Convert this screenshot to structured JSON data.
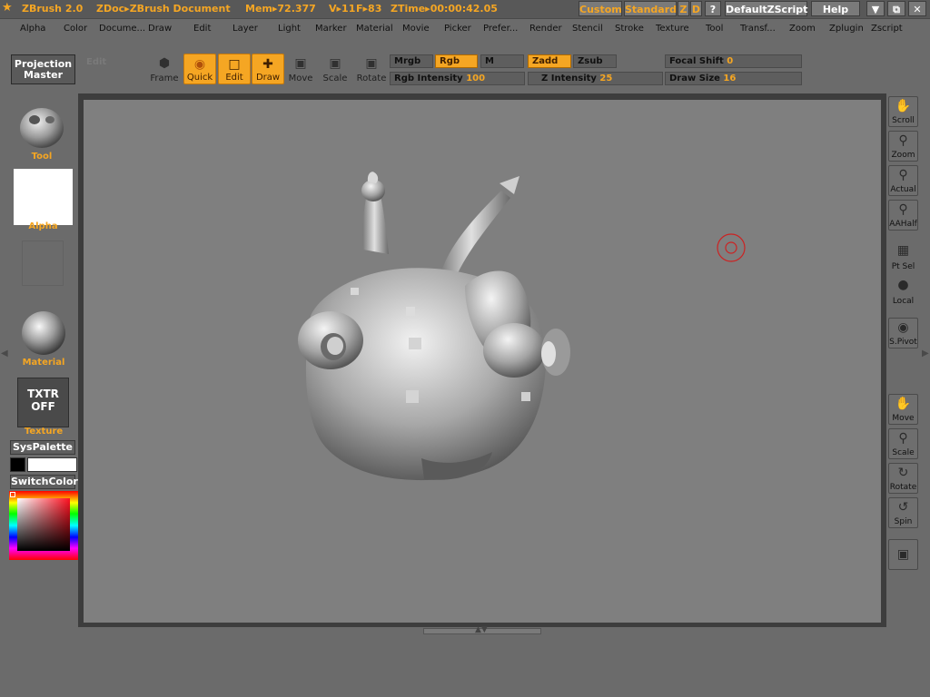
{
  "titlebar": {
    "app": "ZBrush 2.0",
    "doc": "ZDoc▸ZBrush Document",
    "mem": "Mem▸72.377",
    "verts": "V▸11",
    "faces": "F▸83",
    "ztime": "ZTime▸00:00:42.05",
    "custom": "Custom",
    "standard": "Standard",
    "z": "Z",
    "d": "D",
    "q": "?",
    "script": "DefaultZScript",
    "help": "Help"
  },
  "menu": [
    "Alpha",
    "Color",
    "Docume...",
    "Draw",
    "Edit",
    "Layer",
    "Light",
    "Marker",
    "Material",
    "Movie",
    "Picker",
    "Prefer...",
    "Render",
    "Stencil",
    "Stroke",
    "Texture",
    "Tool",
    "Transf...",
    "Zoom",
    "Zplugin",
    "Zscript"
  ],
  "toolbar": {
    "projection_master": "Projection Master",
    "edit_label": "Edit",
    "frame": "Frame",
    "quick": "Quick",
    "edit": "Edit",
    "draw": "Draw",
    "move": "Move",
    "scale": "Scale",
    "rotate": "Rotate",
    "mrgb": "Mrgb",
    "rgb": "Rgb",
    "m": "M",
    "zadd": "Zadd",
    "zsub": "Zsub",
    "rgb_intensity_label": "Rgb Intensity",
    "rgb_intensity_value": "100",
    "z_intensity_label": "Z Intensity",
    "z_intensity_value": "25",
    "focal_shift_label": "Focal Shift",
    "focal_shift_value": "0",
    "draw_size_label": "Draw Size",
    "draw_size_value": "16"
  },
  "left_panel": {
    "tool": "Tool",
    "alpha": "Alpha",
    "material": "Material",
    "texture_button": "TXTR OFF",
    "texture": "Texture",
    "syspalette": "SysPalette",
    "switchcolor": "SwitchColor"
  },
  "right_shelf": [
    "Scroll",
    "Zoom",
    "Actual",
    "AAHalf",
    "Pt Sel",
    "Local",
    "S.Pivot",
    "Move",
    "Scale",
    "Rotate",
    "Spin"
  ],
  "colors": {
    "accent": "#f5a623",
    "brush_cursor": "#cc2222"
  }
}
